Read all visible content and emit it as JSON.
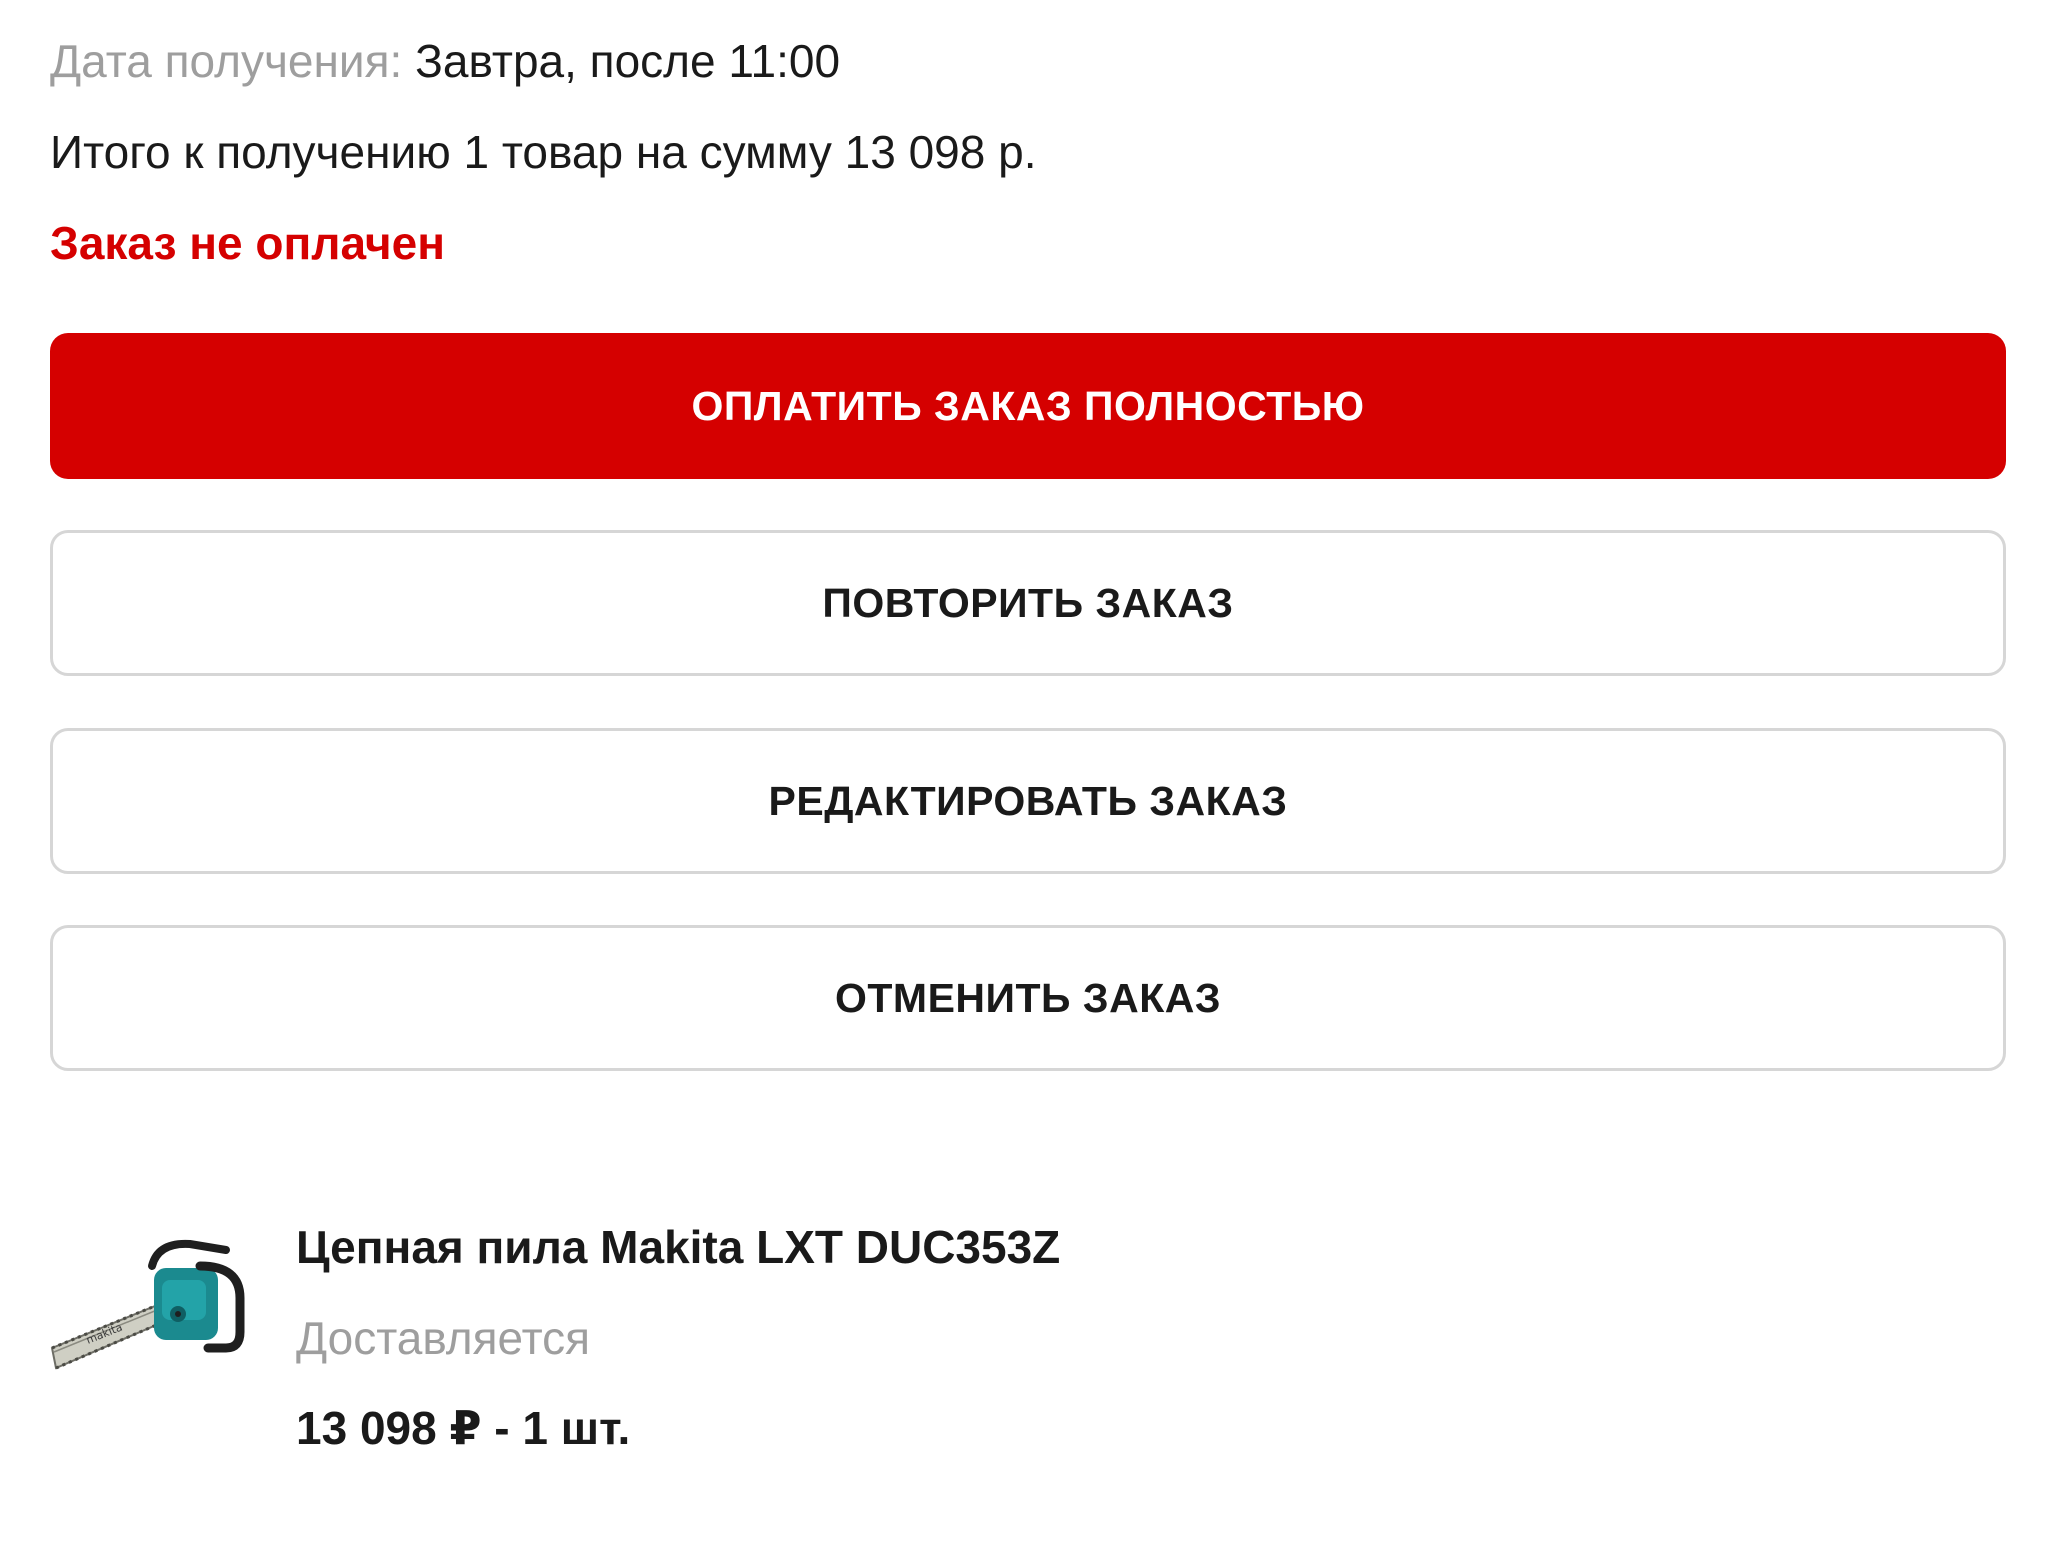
{
  "order": {
    "date_label": "Дата получения:",
    "date_value": " Завтра, после 11:00",
    "summary": "Итого к получению 1 товар на сумму 13 098 р.",
    "payment_status": "Заказ не оплачен"
  },
  "actions": {
    "pay_full_label": "ОПЛАТИТЬ ЗАКАЗ ПОЛНОСТЬЮ",
    "repeat_label": "ПОВТОРИТЬ ЗАКАЗ",
    "edit_label": "РЕДАКТИРОВАТЬ ЗАКАЗ",
    "cancel_label": "ОТМЕНИТЬ ЗАКАЗ"
  },
  "product": {
    "name": "Цепная пила Makita LXT DUC353Z",
    "status": "Доставляется",
    "price_qty": "13 098 ₽ - 1 шт.",
    "image_icon": "chainsaw-image",
    "image_brand_text": "makita"
  },
  "colors": {
    "accent": "#d50000",
    "muted_text": "#9e9e9e",
    "border": "#d6d6d6",
    "product_body": "#1b8a8f"
  }
}
